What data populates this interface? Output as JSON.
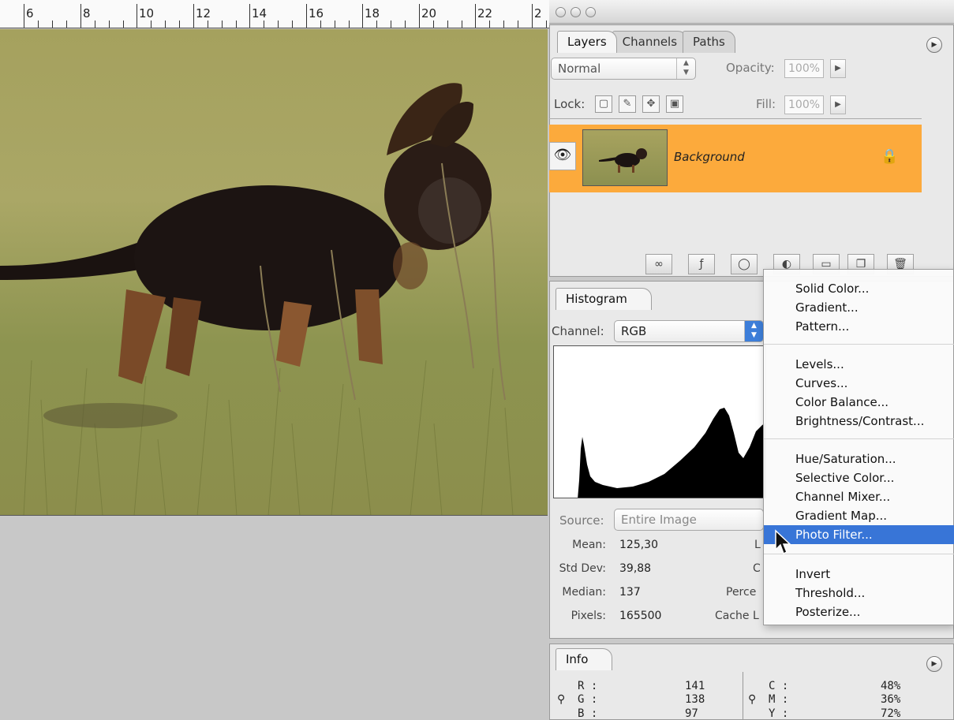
{
  "ruler": {
    "labels": [
      "6",
      "8",
      "10",
      "12",
      "14",
      "16",
      "18",
      "20",
      "22",
      "2"
    ]
  },
  "layers_panel": {
    "tabs": [
      {
        "label": "Layers"
      },
      {
        "label": "Channels"
      },
      {
        "label": "Paths"
      }
    ],
    "blend_mode": "Normal",
    "opacity_label": "Opacity:",
    "opacity_value": "100%",
    "lock_label": "Lock:",
    "fill_label": "Fill:",
    "fill_value": "100%",
    "layer": {
      "name": "Background"
    }
  },
  "histogram_panel": {
    "tab": "Histogram",
    "channel_label": "Channel:",
    "channel_value": "RGB",
    "source_label": "Source:",
    "source_value": "Entire Image",
    "stats": {
      "mean_label": "Mean:",
      "mean": "125,30",
      "std_dev_label": "Std Dev:",
      "std_dev": "39,88",
      "median_label": "Median:",
      "median": "137",
      "pixels_label": "Pixels:",
      "pixels": "165500"
    },
    "right_partial": {
      "l": "L",
      "c": "C",
      "perce": "Perce",
      "cache": "Cache L"
    }
  },
  "adjustment_menu": {
    "items": [
      "Solid Color...",
      "Gradient...",
      "Pattern...",
      "Levels...",
      "Curves...",
      "Color Balance...",
      "Brightness/Contrast...",
      "Hue/Saturation...",
      "Selective Color...",
      "Channel Mixer...",
      "Gradient Map...",
      "Photo Filter...",
      "Invert",
      "Threshold...",
      "Posterize..."
    ],
    "selected": "Photo Filter..."
  },
  "info_panel": {
    "tab": "Info",
    "r_label": "R :",
    "r": "141",
    "g_label": "G :",
    "g": "138",
    "b_label": "B :",
    "b": "97",
    "c_label": "C :",
    "c": "48%",
    "m_label": "M :",
    "m": "36%",
    "y_label": "Y :",
    "y": "72%"
  },
  "colors": {
    "layer_selected": "#fcaa3c",
    "menu_highlight": "#3875d7",
    "grass": "#a5a15e"
  }
}
